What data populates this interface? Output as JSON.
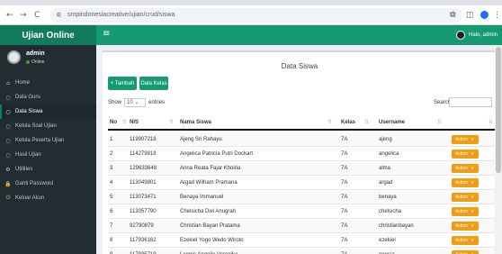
{
  "browser": {
    "url": "smpindonesiacreative/ujian/crud/siswa",
    "nav": {
      "back": "←",
      "forward": "→",
      "reload": "C",
      "tune": "⚟"
    },
    "icons": {
      "star": "☆",
      "extensions": "⧉",
      "panel": "◫"
    }
  },
  "app": {
    "brand": "Ujian Online"
  },
  "user": {
    "name": "admin",
    "status": "Online",
    "nav_name": "Halo, admin"
  },
  "sidebar": {
    "items": [
      {
        "label": "Home",
        "icon": "home-icon",
        "glyph": "⌂",
        "active": false
      },
      {
        "label": "Data Guru",
        "icon": "circle-icon",
        "glyph": "○",
        "active": false
      },
      {
        "label": "Data Siswa",
        "icon": "circle-icon",
        "glyph": "○",
        "active": true
      },
      {
        "label": "Kelola Soal Ujian",
        "icon": "circle-icon",
        "glyph": "○",
        "active": false
      },
      {
        "label": "Kelola Peserta Ujian",
        "icon": "circle-icon",
        "glyph": "○",
        "active": false
      },
      {
        "label": "Hasil Ujian",
        "icon": "circle-icon",
        "glyph": "○",
        "active": false
      },
      {
        "label": "Utilities",
        "icon": "cogs-icon",
        "glyph": "⚙",
        "active": false
      },
      {
        "label": "Ganti Password",
        "icon": "lock-icon",
        "glyph": "🔒",
        "active": false
      },
      {
        "label": "Keluar Akun",
        "icon": "logout-icon",
        "glyph": "⏻",
        "active": false
      }
    ]
  },
  "main": {
    "title": "Data Siswa",
    "buttons": {
      "tambah": "+ Tambah",
      "kelas": "Data Kelas"
    },
    "show": {
      "prefix": "Show",
      "value": "10",
      "suffix": "entries"
    },
    "search_label": "Search:",
    "columns": [
      "No",
      "NIS",
      "Nama Siswa",
      "Kelas",
      "Username",
      ""
    ],
    "rows": [
      {
        "no": "1",
        "nis": "119907218",
        "nama": "Ajeng Sri Rahayu",
        "kelas": "7A",
        "username": "ajeng"
      },
      {
        "no": "2",
        "nis": "114279818",
        "nama": "Angelica Patricia Putri Dockart",
        "kelas": "7A",
        "username": "angelica"
      },
      {
        "no": "3",
        "nis": "129633648",
        "nama": "Anna Reata Fajar Khoiria",
        "kelas": "7A",
        "username": "alma"
      },
      {
        "no": "4",
        "nis": "113049801",
        "nama": "Argad Wilham Pramana",
        "kelas": "7A",
        "username": "argad"
      },
      {
        "no": "5",
        "nis": "113073471",
        "nama": "Benaya Immanuel",
        "kelas": "7A",
        "username": "benaya"
      },
      {
        "no": "6",
        "nis": "113057790",
        "nama": "Chelsicha Dwi Anugrah",
        "kelas": "7A",
        "username": "chelsicha"
      },
      {
        "no": "7",
        "nis": "92790879",
        "nama": "Christian Bayan Pratama",
        "kelas": "7A",
        "username": "christianbayan"
      },
      {
        "no": "8",
        "nis": "117936162",
        "nama": "Ezekiel Yogo Wedo Wiroto",
        "kelas": "7A",
        "username": "ezekiel"
      },
      {
        "no": "9",
        "nis": "117935719",
        "nama": "Leonie Angelie Veronika",
        "kelas": "7A",
        "username": "geosia"
      }
    ],
    "action_label": "Action"
  },
  "colors": {
    "brand": "#127a5d",
    "navbar": "#159a73",
    "sidebar": "#222d32",
    "action": "#f39c12"
  }
}
